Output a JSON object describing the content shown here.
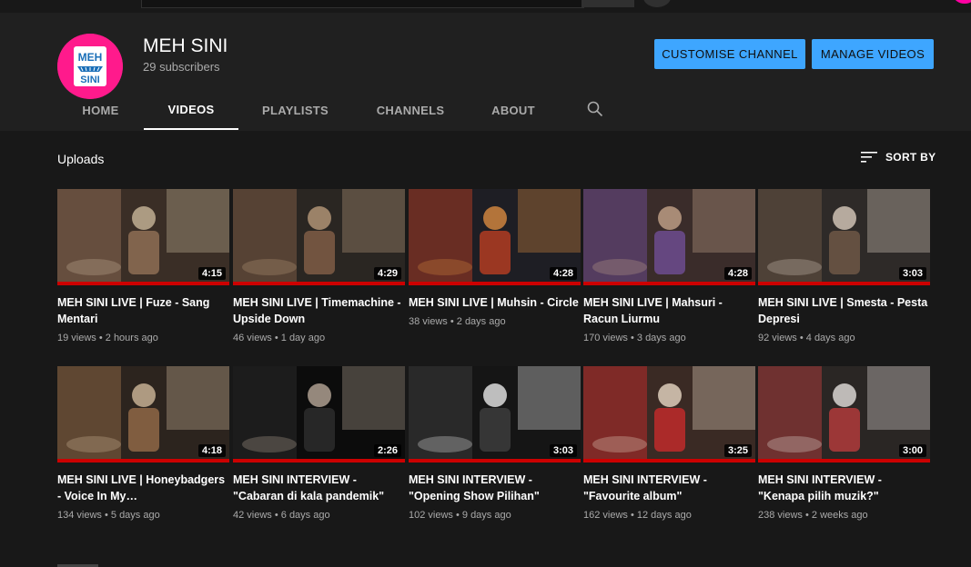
{
  "channel": {
    "name": "MEH SINI",
    "subscribers": "29 subscribers",
    "customise_label": "CUSTOMISE CHANNEL",
    "manage_label": "MANAGE VIDEOS",
    "logo_text_top": "MEH",
    "logo_text_bottom": "SINI"
  },
  "tabs": [
    {
      "label": "HOME",
      "active": false
    },
    {
      "label": "VIDEOS",
      "active": true
    },
    {
      "label": "PLAYLISTS",
      "active": false
    },
    {
      "label": "CHANNELS",
      "active": false
    },
    {
      "label": "ABOUT",
      "active": false
    }
  ],
  "section": {
    "title": "Uploads",
    "sort_label": "SORT BY"
  },
  "videos": [
    {
      "title": "MEH SINI LIVE | Fuze - Sang Mentari",
      "views": "19 views",
      "age": "2 hours ago",
      "duration": "4:15",
      "palette": [
        "#3a2e26",
        "#8a6a52",
        "#c9b79a"
      ]
    },
    {
      "title": "MEH SINI LIVE | Timemachine - Upside Down",
      "views": "46 views",
      "age": "1 day ago",
      "duration": "4:29",
      "palette": [
        "#2a2622",
        "#7a5a44",
        "#b89a7a"
      ]
    },
    {
      "title": "MEH SINI LIVE | Muhsin - Circle",
      "views": "38 views",
      "age": "2 days ago",
      "duration": "4:28",
      "palette": [
        "#1e1e24",
        "#a83a22",
        "#d88a40"
      ]
    },
    {
      "title": "MEH SINI LIVE | Mahsuri - Racun Liurmu",
      "views": "170 views",
      "age": "3 days ago",
      "duration": "4:28",
      "palette": [
        "#3a2c2a",
        "#6a4a8a",
        "#c4a48a"
      ]
    },
    {
      "title": "MEH SINI LIVE | Smesta - Pesta Depresi",
      "views": "92 views",
      "age": "4 days ago",
      "duration": "3:03",
      "palette": [
        "#2e2a28",
        "#6a5444",
        "#d8cabc"
      ]
    },
    {
      "title": "MEH SINI LIVE | Honeybadgers - Voice In My…",
      "views": "134 views",
      "age": "5 days ago",
      "duration": "4:18",
      "palette": [
        "#2c241e",
        "#8a6444",
        "#cfb89a"
      ]
    },
    {
      "title": "MEH SINI INTERVIEW - \"Cabaran di kala pandemik\"",
      "views": "42 views",
      "age": "6 days ago",
      "duration": "2:26",
      "palette": [
        "#0c0c0c",
        "#2a2a2a",
        "#b8a898"
      ]
    },
    {
      "title": "MEH SINI INTERVIEW - \"Opening Show Pilihan\"",
      "views": "102 views",
      "age": "9 days ago",
      "duration": "3:03",
      "palette": [
        "#151515",
        "#3a3a3a",
        "#e8e8e8"
      ]
    },
    {
      "title": "MEH SINI INTERVIEW - \"Favourite album\"",
      "views": "162 views",
      "age": "12 days ago",
      "duration": "3:25",
      "palette": [
        "#3a2a24",
        "#b82a2a",
        "#e8d8c4"
      ]
    },
    {
      "title": "MEH SINI INTERVIEW - \"Kenapa pilih muzik?\"",
      "views": "238 views",
      "age": "2 weeks ago",
      "duration": "3:00",
      "palette": [
        "#2a2624",
        "#a83a3a",
        "#e4e0dc"
      ]
    }
  ]
}
